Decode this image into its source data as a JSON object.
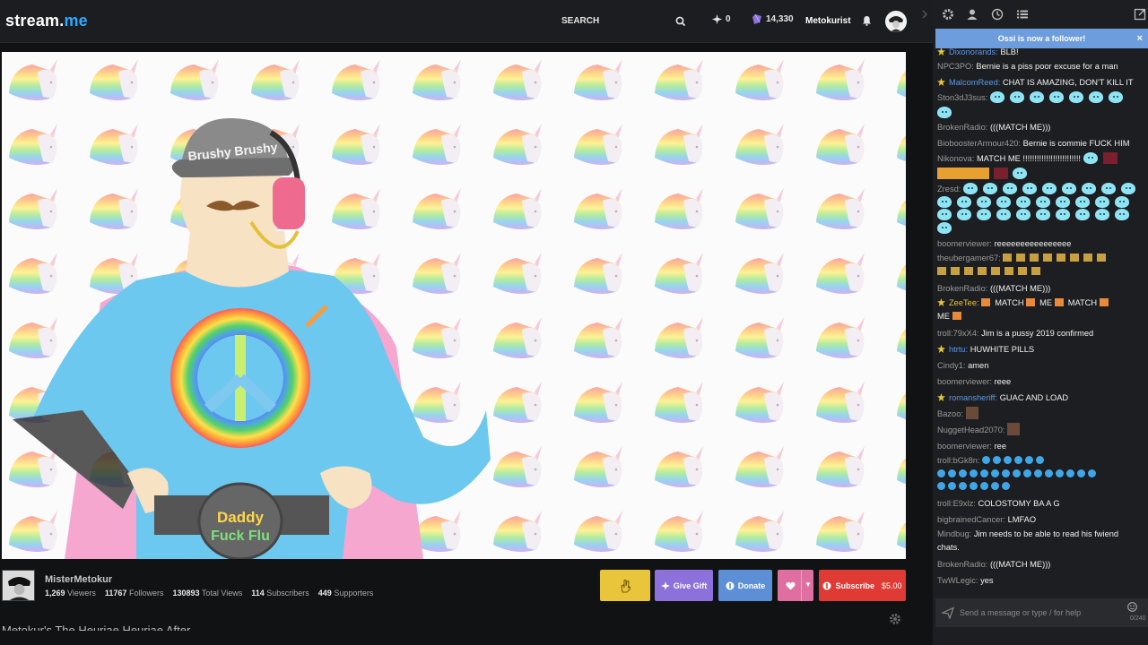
{
  "topbar": {
    "logo_main": "stream.",
    "logo_accent": "me",
    "search_label": "SEARCH",
    "sparks_count": "0",
    "gems_count": "14,330",
    "username": "Metokurist"
  },
  "video": {
    "cap_text": "Brushy Brushy",
    "belt_line1": "Daddy",
    "belt_line2": "Fuck Flu"
  },
  "channel": {
    "name": "MisterMetokur",
    "viewers_num": "1,269",
    "viewers_label": "Viewers",
    "followers_num": "11767",
    "followers_label": "Followers",
    "total_views_num": "130893",
    "total_views_label": "Total Views",
    "subscribers_num": "114",
    "subscribers_label": "Subscribers",
    "supporters_num": "449",
    "supporters_label": "Supporters",
    "partial_title": "Metokur's The Heuriae Heuriae After"
  },
  "actions": {
    "give_gift": "Give Gift",
    "donate": "Donate",
    "subscribe": "Subscribe",
    "subscribe_price": "$5.00"
  },
  "chat": {
    "follower_banner": "Ossi is now a follower!",
    "close_glyph": "×",
    "input_placeholder": "Send a message or type / for help",
    "char_count": "0/240",
    "messages": [
      {
        "user": "Dixonorands:",
        "text": "BLB!"
      },
      {
        "user": "NPC3PO:",
        "text": "Bernie is a piss poor excuse for a man"
      },
      {
        "user": "MalcomReed:",
        "text": "CHAT IS AMAZING, DON'T KILL IT"
      },
      {
        "user": "Ston3dJ3sus:",
        "text": ""
      },
      {
        "user": "BrokenRadio:",
        "text": "(((MATCH ME)))"
      },
      {
        "user": "BioboosterArmour420:",
        "text": "Bernie is commie FUCK HIM"
      },
      {
        "user": "Nikonova:",
        "text": "MATCH ME !!!!!!!!!!!!!!!!!!!!!!!!!"
      },
      {
        "user": "Zresd:",
        "text": ""
      },
      {
        "user": "boomerviewer:",
        "text": "reeeeeeeeeeeeeeee"
      },
      {
        "user": "theubergamer67:",
        "text": ""
      },
      {
        "user": "BrokenRadio:",
        "text": "(((MATCH ME)))"
      },
      {
        "user": "ZeeTee:",
        "text_1": "MATCH",
        "text_2": "ME",
        "text_3": "MATCH",
        "text_4": "ME"
      },
      {
        "user": "troll:79xX4:",
        "text": "Jim is a pussy 2019 confirmed"
      },
      {
        "user": "htrtu:",
        "text": "HUWHITE PILLS"
      },
      {
        "user": "Cindy1:",
        "text": "amen"
      },
      {
        "user": "boomerviewer:",
        "text": "reee"
      },
      {
        "user": "romansheriff:",
        "text": "GUAC AND LOAD"
      },
      {
        "user": "Bazoo:",
        "text": ""
      },
      {
        "user": "NuggetHead2070:",
        "text": ""
      },
      {
        "user": "boomerviewer:",
        "text": "ree"
      },
      {
        "user": "troll:bGk8n:",
        "text": ""
      },
      {
        "user": "troll:E9xlz:",
        "text": "COLOSTOMY BA A G"
      },
      {
        "user": "bigbrainedCancer:",
        "text": "LMFAO"
      },
      {
        "user": "Mindbug:",
        "text": "Jim needs to be able to read his fwiend chats."
      },
      {
        "user": "BrokenRadio:",
        "text": "(((MATCH ME)))"
      },
      {
        "user": "TwWLegic:",
        "text": "yes"
      }
    ]
  },
  "colors": {
    "topbar_bg": "#1c1d20",
    "chat_bg": "#1d1e21",
    "follower_banner": "#6d9ddd",
    "subscribe_red": "#e03a34",
    "gift_purple": "#8b71d9",
    "donate_blue": "#5d8fd6",
    "heart_pink": "#e06fa1",
    "hand_yellow": "#e8c53a"
  },
  "icons": {
    "search": "search-icon",
    "spark": "spark-icon",
    "gem": "gem-icon",
    "bell": "bell-icon",
    "gear": "gear-icon",
    "user": "user-icon",
    "history": "history-icon",
    "list": "list-icon",
    "popout": "popout-icon",
    "send": "send-icon"
  }
}
